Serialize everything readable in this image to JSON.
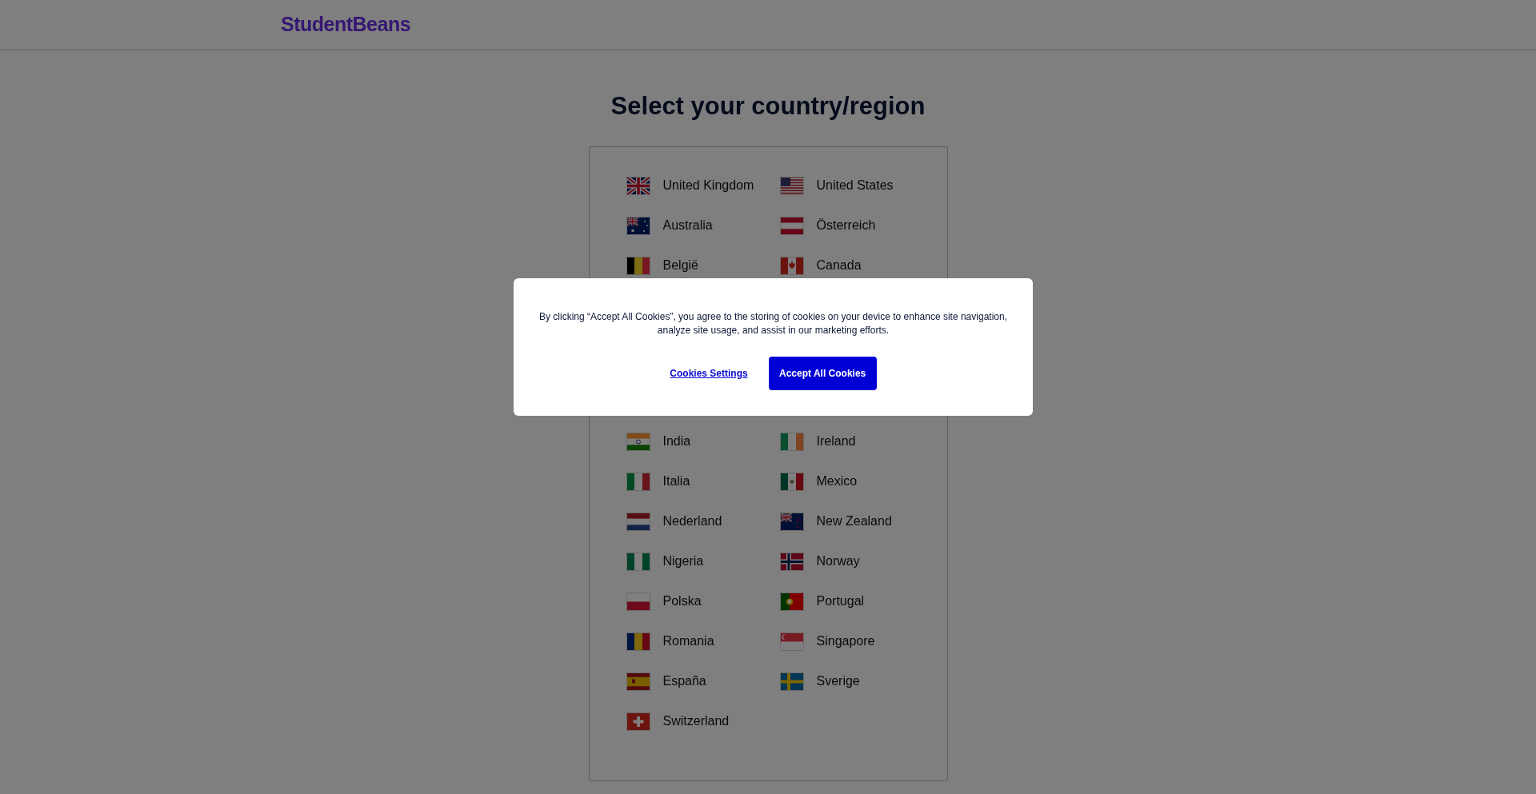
{
  "header": {
    "logo": "StudentBeans"
  },
  "title": "Select your country/region",
  "countries": [
    {
      "name": "United Kingdom"
    },
    {
      "name": "United States"
    },
    {
      "name": "Australia"
    },
    {
      "name": "Österreich"
    },
    {
      "name": "België"
    },
    {
      "name": "Canada"
    },
    {
      "name": "India"
    },
    {
      "name": "Ireland"
    },
    {
      "name": "Italia"
    },
    {
      "name": "Mexico"
    },
    {
      "name": "Nederland"
    },
    {
      "name": "New Zealand"
    },
    {
      "name": "Nigeria"
    },
    {
      "name": "Norway"
    },
    {
      "name": "Polska"
    },
    {
      "name": "Portugal"
    },
    {
      "name": "Romania"
    },
    {
      "name": "Singapore"
    },
    {
      "name": "España"
    },
    {
      "name": "Sverige"
    },
    {
      "name": "Switzerland"
    }
  ],
  "cookie_banner": {
    "text": "By clicking “Accept All Cookies”, you agree to the storing of cookies on your device to enhance site navigation, analyze site usage, and assist in our marketing efforts.",
    "settings_link": "Cookies Settings",
    "accept_button": "Accept All Cookies"
  }
}
